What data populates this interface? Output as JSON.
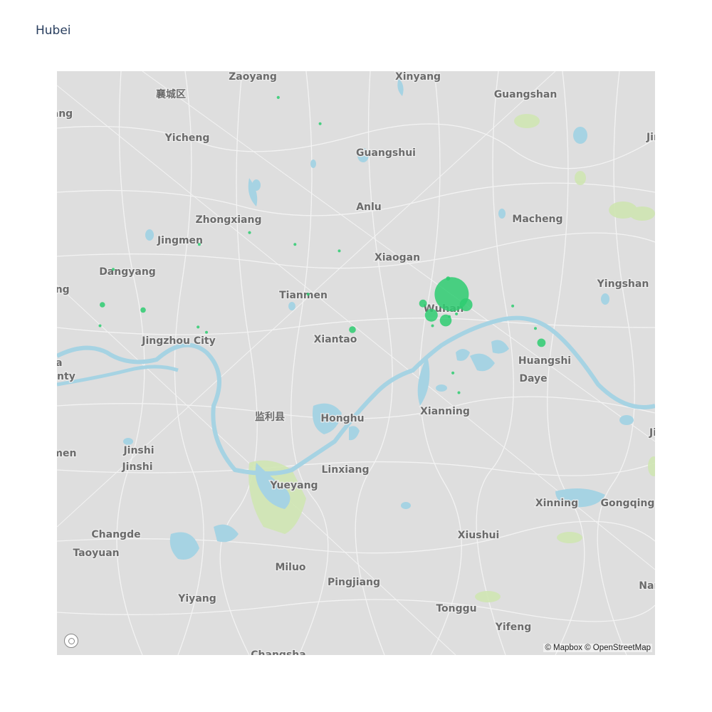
{
  "title": "Hubei",
  "attribution": "© Mapbox © OpenStreetMap",
  "marker_color": "#2ecc71",
  "water_color": "#a6d3e3",
  "park_color": "#cfe5b2",
  "places": [
    {
      "name": "Zaoyang",
      "size": "md"
    },
    {
      "name": "Xinyang",
      "size": "md"
    },
    {
      "name": "襄城区",
      "size": "md"
    },
    {
      "name": "Guangshan",
      "size": "md"
    },
    {
      "name": "okang",
      "size": "md"
    },
    {
      "name": "Yicheng",
      "size": "md"
    },
    {
      "name": "Jinz",
      "size": "md"
    },
    {
      "name": "Guangshui",
      "size": "md"
    },
    {
      "name": "Anlu",
      "size": "md"
    },
    {
      "name": "Zhongxiang",
      "size": "md"
    },
    {
      "name": "Macheng",
      "size": "md"
    },
    {
      "name": "Jingmen",
      "size": "md"
    },
    {
      "name": "Xiaogan",
      "size": "md"
    },
    {
      "name": "Dangyang",
      "size": "md"
    },
    {
      "name": "Yingshan",
      "size": "md"
    },
    {
      "name": "hang",
      "size": "md"
    },
    {
      "name": "Tianmen",
      "size": "md"
    },
    {
      "name": "Wuhan",
      "size": "lg"
    },
    {
      "name": "Jingzhou City",
      "size": "md"
    },
    {
      "name": "Xiantao",
      "size": "md"
    },
    {
      "name": "Huangshi",
      "size": "md"
    },
    {
      "name": "jia",
      "size": "md"
    },
    {
      "name": "County",
      "size": "md"
    },
    {
      "name": "Daye",
      "size": "md"
    },
    {
      "name": "Xianning",
      "size": "md"
    },
    {
      "name": "监利县",
      "size": "md"
    },
    {
      "name": "Honghu",
      "size": "md"
    },
    {
      "name": "Jiu",
      "size": "md"
    },
    {
      "name": "Shimen",
      "size": "md"
    },
    {
      "name": "Jinshi",
      "size": "md"
    },
    {
      "name": "Jinshi",
      "size": "md"
    },
    {
      "name": "Linxiang",
      "size": "md"
    },
    {
      "name": "Yueyang",
      "size": "md"
    },
    {
      "name": "Xinning",
      "size": "md"
    },
    {
      "name": "Gongqingcl",
      "size": "md"
    },
    {
      "name": "Changde",
      "size": "md"
    },
    {
      "name": "Xiushui",
      "size": "md"
    },
    {
      "name": "Taoyuan",
      "size": "md"
    },
    {
      "name": "Miluo",
      "size": "md"
    },
    {
      "name": "Pingjiang",
      "size": "md"
    },
    {
      "name": "Nanch",
      "size": "md"
    },
    {
      "name": "Yiyang",
      "size": "md"
    },
    {
      "name": "Tonggu",
      "size": "md"
    },
    {
      "name": "Yifeng",
      "size": "md"
    },
    {
      "name": "Changsha",
      "size": "md"
    }
  ],
  "markers": [
    {
      "lon": 114.3,
      "lat": 30.6,
      "magnitude": 100
    },
    {
      "lon": 114.42,
      "lat": 30.52,
      "magnitude": 14
    },
    {
      "lon": 114.13,
      "lat": 30.44,
      "magnitude": 14
    },
    {
      "lon": 114.25,
      "lat": 30.4,
      "magnitude": 12
    },
    {
      "lon": 114.06,
      "lat": 30.53,
      "magnitude": 5
    },
    {
      "lon": 115.05,
      "lat": 30.23,
      "magnitude": 6
    },
    {
      "lon": 113.47,
      "lat": 30.33,
      "magnitude": 4
    },
    {
      "lon": 111.38,
      "lat": 30.52,
      "magnitude": 2.5
    },
    {
      "lon": 111.72,
      "lat": 30.48,
      "magnitude": 2.5
    },
    {
      "lon": 114.27,
      "lat": 30.72,
      "magnitude": 1.5
    },
    {
      "lon": 112.85,
      "lat": 32.1,
      "magnitude": 0.8
    },
    {
      "lon": 113.2,
      "lat": 31.9,
      "magnitude": 0.5
    },
    {
      "lon": 112.61,
      "lat": 31.07,
      "magnitude": 0.8
    },
    {
      "lon": 112.19,
      "lat": 30.98,
      "magnitude": 0.5
    },
    {
      "lon": 112.99,
      "lat": 30.98,
      "magnitude": 0.5
    },
    {
      "lon": 113.36,
      "lat": 30.93,
      "magnitude": 0.5
    },
    {
      "lon": 112.18,
      "lat": 30.35,
      "magnitude": 0.8
    },
    {
      "lon": 112.25,
      "lat": 30.31,
      "magnitude": 0.5
    },
    {
      "lon": 113.1,
      "lat": 30.6,
      "magnitude": 0.5
    },
    {
      "lon": 114.14,
      "lat": 30.36,
      "magnitude": 0.5
    },
    {
      "lon": 114.31,
      "lat": 30.0,
      "magnitude": 0.8
    },
    {
      "lon": 114.28,
      "lat": 30.43,
      "magnitude": 0.5
    },
    {
      "lon": 114.34,
      "lat": 30.45,
      "magnitude": 0.5
    },
    {
      "lon": 115.0,
      "lat": 30.34,
      "magnitude": 0.5
    },
    {
      "lon": 114.81,
      "lat": 30.51,
      "magnitude": 0.5
    },
    {
      "lon": 114.36,
      "lat": 29.85,
      "magnitude": 0.5
    },
    {
      "lon": 111.36,
      "lat": 30.36,
      "magnitude": 0.5
    },
    {
      "lon": 111.47,
      "lat": 30.79,
      "magnitude": 0.5
    }
  ]
}
